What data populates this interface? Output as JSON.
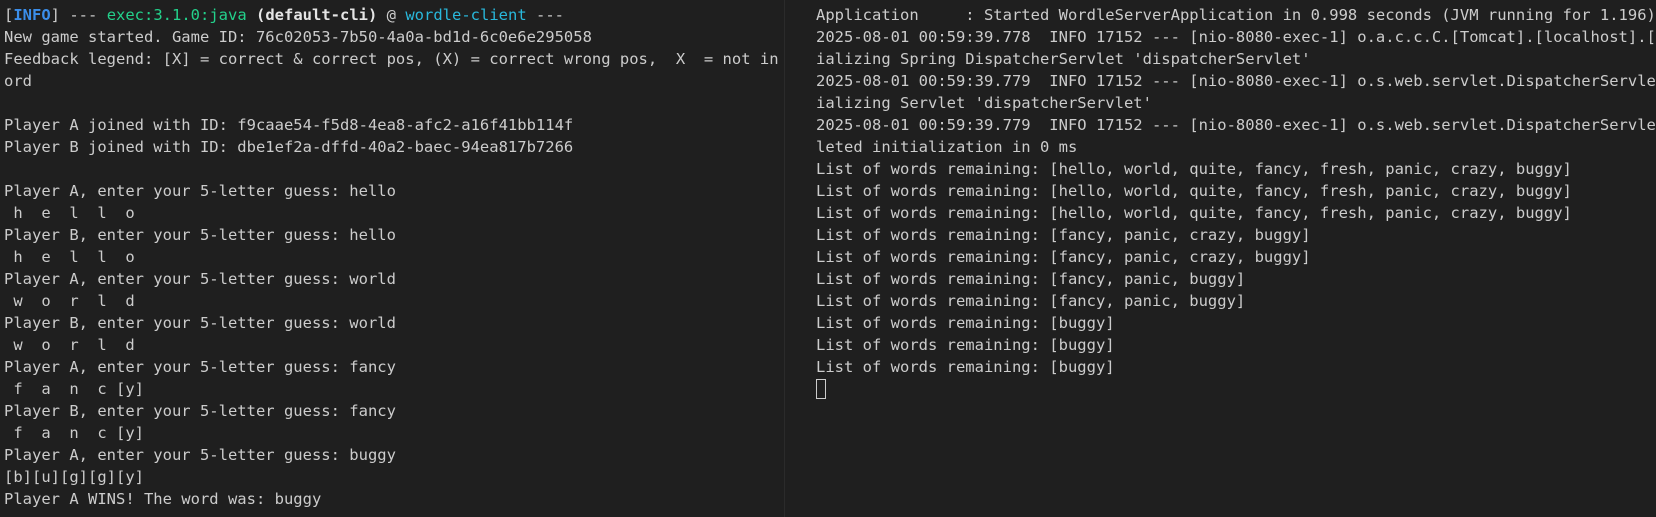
{
  "left_terminal": {
    "header": {
      "bracket_open": "[",
      "level": "INFO",
      "bracket_close": "]",
      "dashes": " --- ",
      "exec": "exec:3.1.0:java",
      "space": " ",
      "execution": "(default-cli)",
      "at": " @ ",
      "module": "wordle-client",
      "trailing": " ---"
    },
    "lines": [
      "New game started. Game ID: 76c02053-7b50-4a0a-bd1d-6c0e6e295058",
      "Feedback legend: [X] = correct & correct pos, (X) = correct wrong pos,  X  = not in w",
      "ord",
      "",
      "Player A joined with ID: f9caae54-f5d8-4ea8-afc2-a16f41bb114f",
      "Player B joined with ID: dbe1ef2a-dffd-40a2-baec-94ea817b7266",
      "",
      "Player A, enter your 5-letter guess: hello",
      " h  e  l  l  o ",
      "Player B, enter your 5-letter guess: hello",
      " h  e  l  l  o ",
      "Player A, enter your 5-letter guess: world",
      " w  o  r  l  d ",
      "Player B, enter your 5-letter guess: world",
      " w  o  r  l  d ",
      "Player A, enter your 5-letter guess: fancy",
      " f  a  n  c [y]",
      "Player B, enter your 5-letter guess: fancy",
      " f  a  n  c [y]",
      "Player A, enter your 5-letter guess: buggy",
      "[b][u][g][g][y]",
      "Player A WINS! The word was: buggy"
    ]
  },
  "right_terminal": {
    "lines": [
      "Application     : Started WordleServerApplication in 0.998 seconds (JVM running for 1.196)",
      "2025-08-01 00:59:39.778  INFO 17152 --- [nio-8080-exec-1] o.a.c.c.C.[Tomcat].[localhost].[/]",
      "ializing Spring DispatcherServlet 'dispatcherServlet'",
      "2025-08-01 00:59:39.779  INFO 17152 --- [nio-8080-exec-1] o.s.web.servlet.DispatcherServlet",
      "ializing Servlet 'dispatcherServlet'",
      "2025-08-01 00:59:39.779  INFO 17152 --- [nio-8080-exec-1] o.s.web.servlet.DispatcherServlet",
      "leted initialization in 0 ms",
      "List of words remaining: [hello, world, quite, fancy, fresh, panic, crazy, buggy]",
      "List of words remaining: [hello, world, quite, fancy, fresh, panic, crazy, buggy]",
      "List of words remaining: [hello, world, quite, fancy, fresh, panic, crazy, buggy]",
      "List of words remaining: [fancy, panic, crazy, buggy]",
      "List of words remaining: [fancy, panic, crazy, buggy]",
      "List of words remaining: [fancy, panic, buggy]",
      "List of words remaining: [fancy, panic, buggy]",
      "List of words remaining: [buggy]",
      "List of words remaining: [buggy]",
      "List of words remaining: [buggy]"
    ]
  },
  "colors": {
    "background": "#1f1f1f",
    "text": "#cccccc",
    "info": "#3b8eea",
    "exec": "#23d18b",
    "module": "#29b8db"
  }
}
